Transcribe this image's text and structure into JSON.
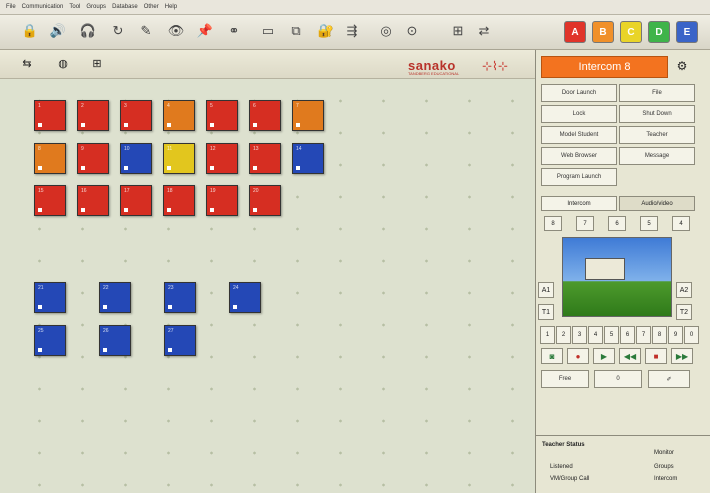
{
  "menu": [
    "File",
    "Communication",
    "Tool",
    "Groups",
    "Database",
    "Other",
    "Help"
  ],
  "toolbar": {
    "icons": [
      "lock-icon",
      "speaker-icon",
      "headset-icon",
      "refresh-icon",
      "pen-icon",
      "eye-icon",
      "pin-icon",
      "group-icon",
      "monitor-icon",
      "student-screen-icon",
      "padlock-icon",
      "send-file-icon",
      "globe-icon",
      "record-icon",
      "pair-icon",
      "translate-icon"
    ],
    "groups": [
      "A",
      "B",
      "C",
      "D",
      "E"
    ],
    "group_colors": [
      "#e0342a",
      "#f0902a",
      "#e9d428",
      "#3fb44a",
      "#3a64c8"
    ]
  },
  "subbar": {
    "brand": "sanako",
    "brand_tag": "TANDBERG EDUCATIONAL"
  },
  "seats": [
    {
      "color": "#d62e22",
      "num": "1"
    },
    {
      "color": "#d62e22",
      "num": "2"
    },
    {
      "color": "#d62e22",
      "num": "3"
    },
    {
      "color": "#e07a1e",
      "num": "4"
    },
    {
      "color": "#d62e22",
      "num": "5"
    },
    {
      "color": "#d62e22",
      "num": "6"
    },
    {
      "color": "#e07a1e",
      "num": "7"
    },
    {
      "color": "#e07a1e",
      "num": "8"
    },
    {
      "color": "#d62e22",
      "num": "9"
    },
    {
      "color": "#2448b6",
      "num": "10"
    },
    {
      "color": "#e2c61e",
      "num": "11"
    },
    {
      "color": "#d62e22",
      "num": "12"
    },
    {
      "color": "#d62e22",
      "num": "13"
    },
    {
      "color": "#2448b6",
      "num": "14"
    },
    {
      "color": "#d62e22",
      "num": "15"
    },
    {
      "color": "#d62e22",
      "num": "16"
    },
    {
      "color": "#d62e22",
      "num": "17"
    },
    {
      "color": "#d62e22",
      "num": "18"
    },
    {
      "color": "#d62e22",
      "num": "19"
    },
    {
      "color": "#d62e22",
      "num": "20"
    },
    {
      "color": "#2448b6",
      "num": "21"
    },
    {
      "color": "#2448b6",
      "num": "22"
    },
    {
      "color": "#2448b6",
      "num": "23"
    },
    {
      "color": "#2448b6",
      "num": "24"
    },
    {
      "color": "#2448b6",
      "num": "25"
    },
    {
      "color": "#2448b6",
      "num": "26"
    },
    {
      "color": "#2448b6",
      "num": "27"
    }
  ],
  "panel": {
    "title": "Intercom 8",
    "buttons": [
      "Door Launch",
      "File",
      "Lock",
      "Shut Down",
      "Model Student",
      "Teacher",
      "Web Browser",
      "Message",
      "Program Launch"
    ],
    "tabs": [
      "Intercom",
      "Audio/video"
    ],
    "channels": [
      "8",
      "7",
      "6",
      "5",
      "4"
    ],
    "side_left": [
      "A1",
      "T1"
    ],
    "side_right": [
      "A2",
      "T2"
    ],
    "numbers": [
      "1",
      "2",
      "3",
      "4",
      "5",
      "6",
      "7",
      "8",
      "9",
      "0"
    ],
    "controls": [
      "◙",
      "●",
      "▶",
      "◀◀",
      "■",
      "▶▶"
    ],
    "bottom": {
      "left": "Free",
      "mid": "0"
    },
    "status": {
      "title": "Teacher Status",
      "lines": [
        "Listened",
        "VM/Group Call"
      ],
      "right": [
        "Monitor",
        "Groups",
        "Intercom"
      ]
    }
  }
}
